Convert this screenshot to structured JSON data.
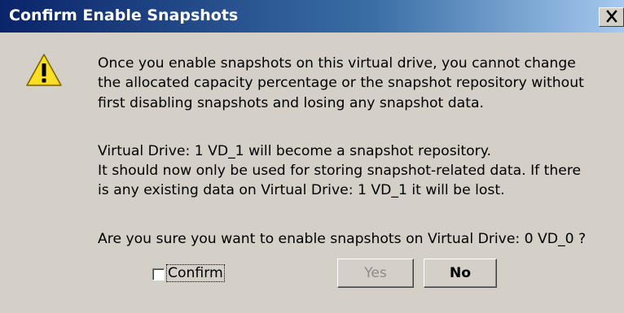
{
  "window": {
    "title": "Confirm Enable Snapshots",
    "close_glyph": "✕"
  },
  "icon": "warning-icon",
  "message": {
    "line1": "Once you enable snapshots on this virtual drive, you cannot change",
    "line2": "the allocated capacity percentage or the snapshot repository without",
    "line3": "first disabling snapshots and losing any snapshot data.",
    "line4": "Virtual Drive: 1 VD_1 will become a snapshot repository.",
    "line5": "It should now only be used for storing snapshot-related data. If there",
    "line6": "is any existing data on Virtual Drive: 1 VD_1 it will be lost.",
    "question": "Are you sure you want to enable snapshots on Virtual Drive: 0 VD_0 ?"
  },
  "confirm": {
    "label": "Confirm",
    "checked": false
  },
  "buttons": {
    "yes_label": "Yes",
    "yes_enabled": false,
    "no_label": "No"
  },
  "colors": {
    "title_bar_start": "#0a246a",
    "title_bar_end": "#a6caf0",
    "dialog_bg": "#d4d0c8",
    "warning_yellow": "#f5d400"
  }
}
